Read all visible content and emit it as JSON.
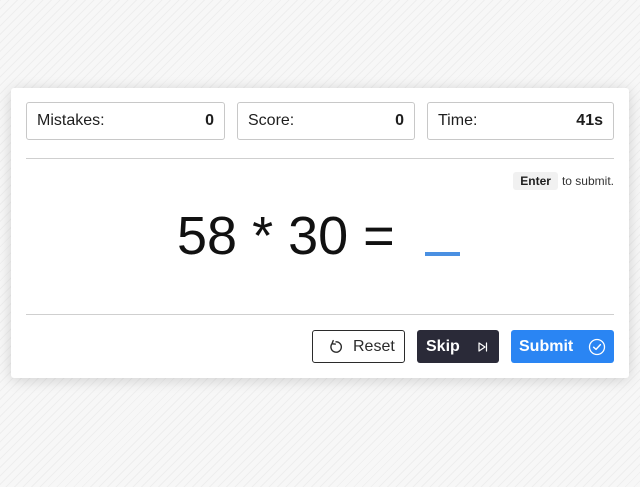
{
  "stats": {
    "mistakes": {
      "label": "Mistakes:",
      "value": "0"
    },
    "score": {
      "label": "Score:",
      "value": "0"
    },
    "time": {
      "label": "Time:",
      "value": "41s"
    }
  },
  "hint": {
    "key": "Enter",
    "text": "to submit."
  },
  "problem": {
    "expression": "58 * 30 =",
    "answer_value": ""
  },
  "buttons": {
    "reset": {
      "label": "Reset",
      "icon": "reset-icon"
    },
    "skip": {
      "label": "Skip",
      "icon": "skip-icon"
    },
    "submit": {
      "label": "Submit",
      "icon": "check-circle-icon"
    }
  },
  "colors": {
    "accent": "#2a85f3",
    "answer_underline": "#4a90e2",
    "skip_bg": "#2a2a38"
  }
}
